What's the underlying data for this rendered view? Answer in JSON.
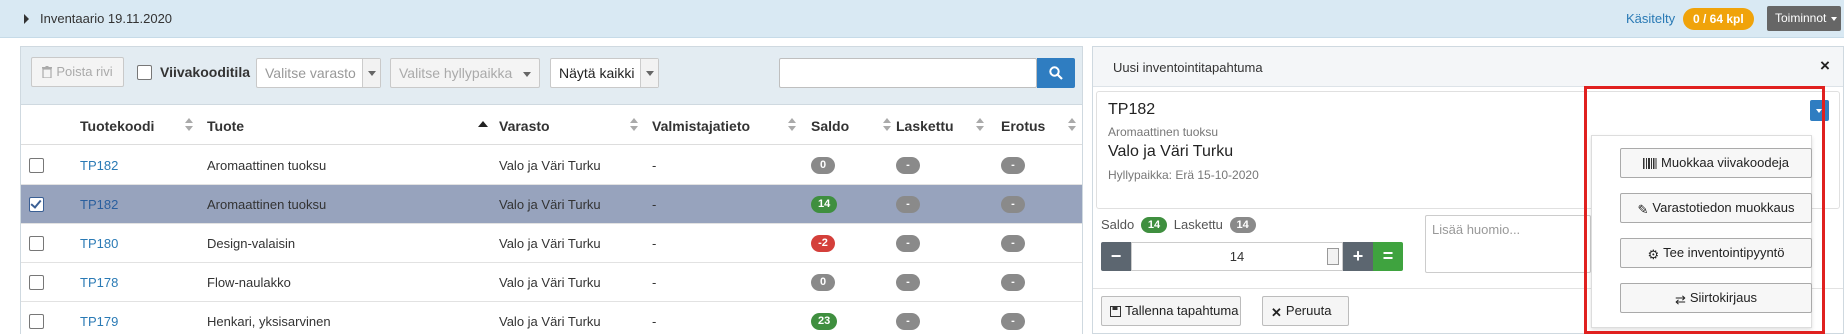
{
  "header": {
    "title": "Inventaario 19.11.2020",
    "processed_label": "Käsitelty",
    "processed_count": "0 / 64 kpl",
    "actions_label": "Toiminnot"
  },
  "toolbar": {
    "delete_row": "Poista rivi",
    "barcode_mode": "Viivakooditila",
    "warehouse_select": "Valitse varasto",
    "shelf_select": "Valitse hyllypaikka",
    "show_filter": "Näytä kaikki"
  },
  "table": {
    "columns": [
      "Tuotekoodi",
      "Tuote",
      "Varasto",
      "Valmistajatieto",
      "Saldo",
      "Laskettu",
      "Erotus"
    ],
    "rows": [
      {
        "code": "TP182",
        "product": "Aromaattinen tuoksu",
        "warehouse": "Valo ja Väri Turku",
        "manufacturer": "-",
        "saldo": "0",
        "saldo_color": "#8a8a8a",
        "counted": "-",
        "diff": "-",
        "selected": false
      },
      {
        "code": "TP182",
        "product": "Aromaattinen tuoksu",
        "warehouse": "Valo ja Väri Turku",
        "manufacturer": "-",
        "saldo": "14",
        "saldo_color": "#3f8f3f",
        "counted": "-",
        "diff": "-",
        "selected": true
      },
      {
        "code": "TP180",
        "product": "Design-valaisin",
        "warehouse": "Valo ja Väri Turku",
        "manufacturer": "-",
        "saldo": "-2",
        "saldo_color": "#d43f3a",
        "counted": "-",
        "diff": "-",
        "selected": false
      },
      {
        "code": "TP178",
        "product": "Flow-naulakko",
        "warehouse": "Valo ja Väri Turku",
        "manufacturer": "-",
        "saldo": "0",
        "saldo_color": "#8a8a8a",
        "counted": "-",
        "diff": "-",
        "selected": false
      },
      {
        "code": "TP179",
        "product": "Henkari, yksisarvinen",
        "warehouse": "Valo ja Väri Turku",
        "manufacturer": "-",
        "saldo": "23",
        "saldo_color": "#3f8f3f",
        "counted": "-",
        "diff": "-",
        "selected": false
      }
    ]
  },
  "panel": {
    "title": "Uusi inventointitapahtuma",
    "close": "×",
    "product_code": "TP182",
    "product_name": "Aromaattinen tuoksu",
    "warehouse": "Valo ja Väri Turku",
    "shelf": "Hyllypaikka: Erä 15-10-2020",
    "saldo_label": "Saldo",
    "saldo_value": "14",
    "counted_label": "Laskettu",
    "counted_value": "14",
    "quantity": "14",
    "minus": "−",
    "plus": "+",
    "equals": "=",
    "note_placeholder": "Lisää huomio...",
    "save": "Tallenna tapahtuma",
    "cancel": "Peruuta"
  },
  "menu": {
    "items": [
      "Muokkaa viivakoodeja",
      "Varastotiedon muokkaus",
      "Tee inventointipyyntö",
      "Siirtokirjaus"
    ]
  },
  "colors": {
    "accent_blue": "#2f7dc1",
    "badge_orange": "#f0a30a",
    "highlight_red": "#e0201f",
    "selected_row": "#97a3bd"
  }
}
